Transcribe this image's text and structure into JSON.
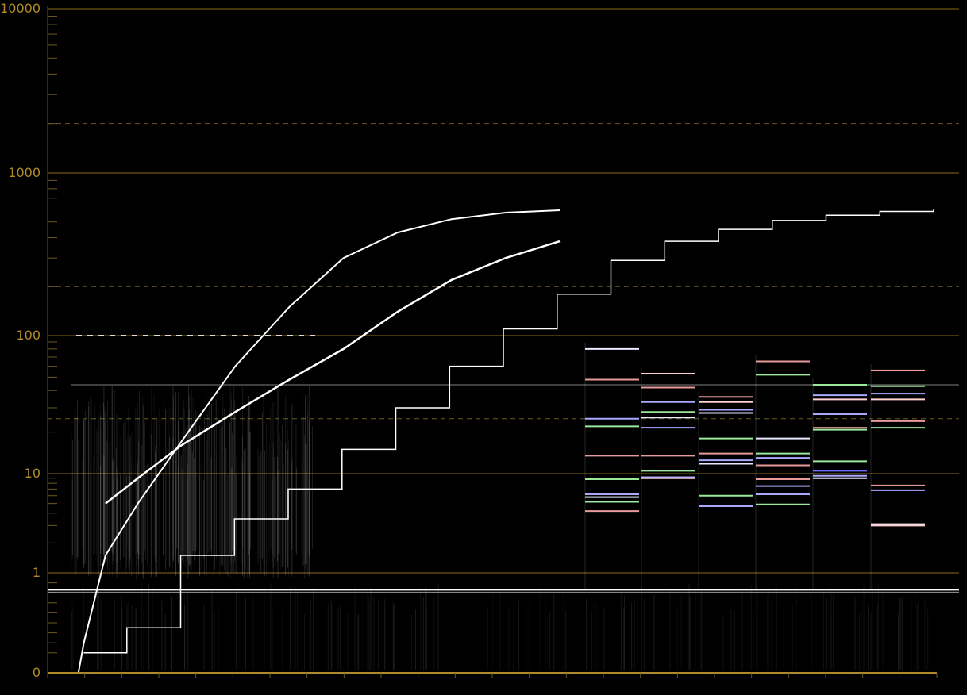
{
  "colors": {
    "background": "#000000",
    "axis": "#b08a2a",
    "grid_major": "#8a6a1a",
    "grid_dashed": "#6b5a20",
    "trace": "#ffffff"
  },
  "chart_data": {
    "type": "line",
    "title": "",
    "xlabel": "",
    "ylabel": "",
    "y_scale": "log (nits, 0 at bottom)",
    "ylim": [
      0,
      10000
    ],
    "y_tick_labels": [
      "10000",
      "1000",
      "100",
      "10",
      "1",
      "0"
    ],
    "major_gridlines": [
      10000,
      1000,
      100,
      10,
      1
    ],
    "dashed_gridlines": [
      2000,
      200,
      25
    ],
    "reference_line": 0.83,
    "x_ticks": 24,
    "series": [
      {
        "kind": "s-curve",
        "points": [
          [
            0.5,
            0
          ],
          [
            1,
            0.3
          ],
          [
            3,
            1.5
          ],
          [
            6,
            5
          ],
          [
            10,
            17
          ],
          [
            15,
            60
          ],
          [
            20,
            150
          ],
          [
            25,
            300
          ],
          [
            30,
            430
          ],
          [
            35,
            520
          ],
          [
            40,
            570
          ],
          [
            45,
            590
          ]
        ]
      },
      {
        "kind": "linear-diagonal",
        "points": [
          [
            3,
            5
          ],
          [
            6,
            9
          ],
          [
            10,
            16
          ],
          [
            15,
            28
          ],
          [
            20,
            48
          ],
          [
            25,
            80
          ],
          [
            30,
            140
          ],
          [
            35,
            220
          ],
          [
            40,
            300
          ],
          [
            45,
            380
          ]
        ]
      },
      {
        "kind": "staircase",
        "points": [
          [
            1,
            0.2
          ],
          [
            5,
            0.45
          ],
          [
            10,
            1.5
          ],
          [
            15,
            3.5
          ],
          [
            20,
            7
          ],
          [
            25,
            15
          ],
          [
            30,
            30
          ],
          [
            35,
            60
          ],
          [
            40,
            110
          ],
          [
            45,
            180
          ],
          [
            50,
            290
          ],
          [
            55,
            380
          ],
          [
            60,
            450
          ],
          [
            65,
            510
          ],
          [
            70,
            550
          ],
          [
            75,
            580
          ],
          [
            80,
            600
          ]
        ]
      }
    ],
    "panels": [
      {
        "lines": [
          {
            "y": 80,
            "color": "#e8eaff"
          },
          {
            "y": 48,
            "color": "#e89a9a"
          },
          {
            "y": 25,
            "color": "#a8a8ff"
          },
          {
            "y": 22,
            "color": "#9ae89a"
          },
          {
            "y": 13.5,
            "color": "#e89a9a"
          },
          {
            "y": 8.8,
            "color": "#9ae89a"
          },
          {
            "y": 6.2,
            "color": "#a8a8ff"
          },
          {
            "y": 5.8,
            "color": "#e8eaff"
          },
          {
            "y": 5.2,
            "color": "#9ae89a"
          },
          {
            "y": 4.2,
            "color": "#e89a9a"
          }
        ]
      },
      {
        "lines": [
          {
            "y": 53,
            "color": "#ffd0d0"
          },
          {
            "y": 42,
            "color": "#e89a9a"
          },
          {
            "y": 33,
            "color": "#a8a8ff"
          },
          {
            "y": 28,
            "color": "#9ae89a"
          },
          {
            "y": 25.5,
            "color": "#e8eaff"
          },
          {
            "y": 21.5,
            "color": "#a8a8ff"
          },
          {
            "y": 13.5,
            "color": "#e89a9a"
          },
          {
            "y": 10.5,
            "color": "#9ae89a"
          },
          {
            "y": 9.2,
            "color": "#a8a8ff"
          },
          {
            "y": 9,
            "color": "#ffd0d0"
          }
        ]
      },
      {
        "lines": [
          {
            "y": 36,
            "color": "#e89a9a"
          },
          {
            "y": 33,
            "color": "#ffd0d0"
          },
          {
            "y": 29,
            "color": "#a8a8ff"
          },
          {
            "y": 27.5,
            "color": "#e8eaff"
          },
          {
            "y": 18,
            "color": "#9ae89a"
          },
          {
            "y": 14,
            "color": "#e89a9a"
          },
          {
            "y": 12.5,
            "color": "#a8a8ff"
          },
          {
            "y": 11.8,
            "color": "#e8eaff"
          },
          {
            "y": 6,
            "color": "#9ae89a"
          },
          {
            "y": 4.7,
            "color": "#a8a8ff"
          }
        ]
      },
      {
        "lines": [
          {
            "y": 65,
            "color": "#e89a9a"
          },
          {
            "y": 52,
            "color": "#9ae89a"
          },
          {
            "y": 18,
            "color": "#e8eaff"
          },
          {
            "y": 14,
            "color": "#9ae89a"
          },
          {
            "y": 13,
            "color": "#a8a8ff"
          },
          {
            "y": 11.5,
            "color": "#e89a9a"
          },
          {
            "y": 8.8,
            "color": "#e89a9a"
          },
          {
            "y": 7.5,
            "color": "#a8a8ff"
          },
          {
            "y": 6.2,
            "color": "#a8a8ff"
          },
          {
            "y": 4.9,
            "color": "#9ae89a"
          }
        ]
      },
      {
        "lines": [
          {
            "y": 44,
            "color": "#9ae89a"
          },
          {
            "y": 37,
            "color": "#a8a8ff"
          },
          {
            "y": 34.5,
            "color": "#ffd0d0"
          },
          {
            "y": 27,
            "color": "#a8a8ff"
          },
          {
            "y": 21.5,
            "color": "#e89a9a"
          },
          {
            "y": 20.8,
            "color": "#9ae89a"
          },
          {
            "y": 12.3,
            "color": "#9ae89a"
          },
          {
            "y": 10.5,
            "color": "#6a6aff"
          },
          {
            "y": 9.5,
            "color": "#a8a8ff"
          },
          {
            "y": 9,
            "color": "#e8eaff"
          }
        ]
      },
      {
        "lines": [
          {
            "y": 56,
            "color": "#e89a9a"
          },
          {
            "y": 43,
            "color": "#9ae89a"
          },
          {
            "y": 38,
            "color": "#a8a8ff"
          },
          {
            "y": 34.5,
            "color": "#ffd0d0"
          },
          {
            "y": 24,
            "color": "#e89a9a"
          },
          {
            "y": 21.5,
            "color": "#9ae89a"
          },
          {
            "y": 7.6,
            "color": "#e89a9a"
          },
          {
            "y": 6.8,
            "color": "#a8a8ff"
          },
          {
            "y": 3.1,
            "color": "#e8eaff"
          },
          {
            "y": 3,
            "color": "#ffd0d0"
          }
        ]
      }
    ]
  }
}
